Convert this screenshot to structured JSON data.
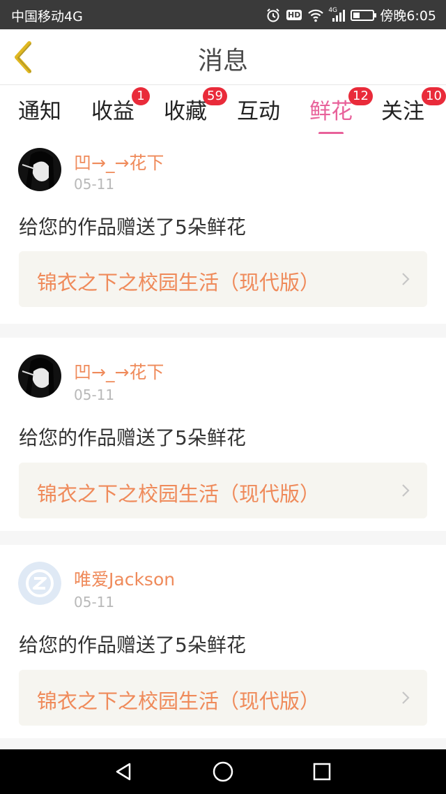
{
  "status_bar": {
    "carrier": "中国移动4G",
    "hd": "HD",
    "network": "4G",
    "battery_level": 0.35,
    "time_text": "傍晚6:05"
  },
  "header": {
    "title": "消息",
    "back_icon": "chevron-left-icon"
  },
  "tabs": [
    {
      "label": "通知",
      "badge": "",
      "active": false
    },
    {
      "label": "收益",
      "badge": "1",
      "active": false
    },
    {
      "label": "收藏",
      "badge": "59",
      "active": false
    },
    {
      "label": "互动",
      "badge": "",
      "active": false
    },
    {
      "label": "鲜花",
      "badge": "12",
      "active": true
    },
    {
      "label": "关注",
      "badge": "10",
      "active": false
    }
  ],
  "messages": [
    {
      "sender": "凹→_→花下",
      "date": "05-11",
      "text": "给您的作品赠送了5朵鲜花",
      "work_title": "锦衣之下之校园生活（现代版）",
      "avatar": "photo-avatar"
    },
    {
      "sender": "凹→_→花下",
      "date": "05-11",
      "text": "给您的作品赠送了5朵鲜花",
      "work_title": "锦衣之下之校园生活（现代版）",
      "avatar": "photo-avatar"
    },
    {
      "sender": "唯爱Jackson",
      "date": "05-11",
      "text": "给您的作品赠送了5朵鲜花",
      "work_title": "锦衣之下之校园生活（现代版）",
      "avatar": "default-avatar"
    }
  ],
  "colors": {
    "accent_pink": "#e8619a",
    "accent_orange": "#ef8a5a",
    "badge_red": "#e92b3a",
    "back_yellow": "#e0b822"
  },
  "nav_icons": [
    "back-triangle-icon",
    "home-circle-icon",
    "recents-square-icon"
  ]
}
